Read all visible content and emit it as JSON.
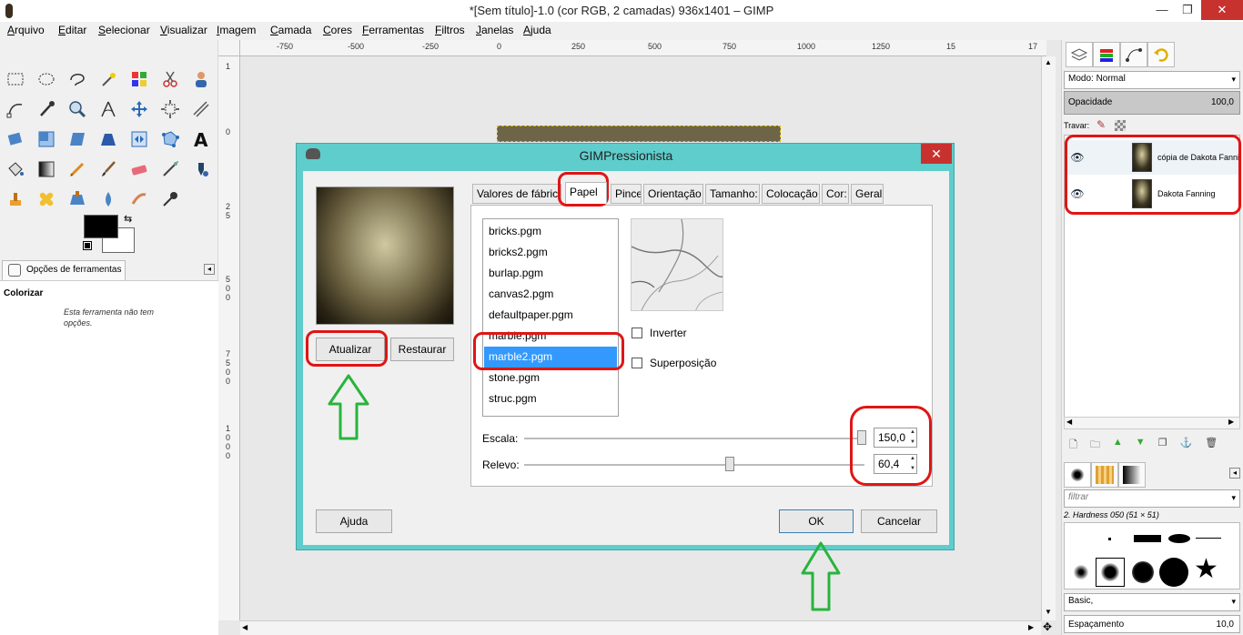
{
  "window": {
    "title": "*[Sem título]-1.0 (cor RGB, 2 camadas) 936x1401 – GIMP"
  },
  "menubar": [
    "Arquivo",
    "Editar",
    "Selecionar",
    "Visualizar",
    "Imagem",
    "Camada",
    "Cores",
    "Ferramentas",
    "Filtros",
    "Janelas",
    "Ajuda"
  ],
  "tool_options": {
    "tab_label": "Opções de ferramentas",
    "tool_name": "Colorizar",
    "note": "Esta ferramenta não tem opções."
  },
  "ruler": {
    "h_labels": [
      "-750",
      "-500",
      "-250",
      "0",
      "250",
      "500",
      "750",
      "1000",
      "1250",
      "15",
      "17"
    ],
    "v_labels": [
      "1",
      "0",
      "2",
      "5",
      "5",
      "0",
      "0",
      "7",
      "5",
      "0",
      "0",
      "1",
      "0",
      "0",
      "0"
    ]
  },
  "layers_dock": {
    "mode_label": "Modo: Normal",
    "opacity_label": "Opacidade",
    "opacity_value": "100,0",
    "lock_label": "Travar:",
    "layers": [
      {
        "name": "cópia de Dakota Fanning"
      },
      {
        "name": "Dakota Fanning"
      }
    ]
  },
  "brushes_dock": {
    "filter_placeholder": "filtrar",
    "brush_name": "2. Hardness 050 (51 × 51)",
    "preset": "Basic,",
    "spacing_label": "Espaçamento",
    "spacing_value": "10,0"
  },
  "dialog": {
    "title": "GIMPressionista",
    "update_button": "Atualizar",
    "reset_button": "Restaurar",
    "help_button": "Ajuda",
    "ok_button": "OK",
    "cancel_button": "Cancelar",
    "tabs": [
      "Valores de fábrica",
      "Papel",
      "Pincel",
      "Orientação",
      "Tamanho:",
      "Colocação",
      "Cor:",
      "Geral"
    ],
    "active_tab": "Papel",
    "textures": [
      "bricks.pgm",
      "bricks2.pgm",
      "burlap.pgm",
      "canvas2.pgm",
      "defaultpaper.pgm",
      "marble.pgm",
      "marble2.pgm",
      "stone.pgm",
      "struc.pgm"
    ],
    "selected_texture": "marble2.pgm",
    "invert_label": "Inverter",
    "overlay_label": "Superposição",
    "scale_label": "Escala:",
    "scale_value": "150,0",
    "relief_label": "Relevo:",
    "relief_value": "60,4"
  }
}
